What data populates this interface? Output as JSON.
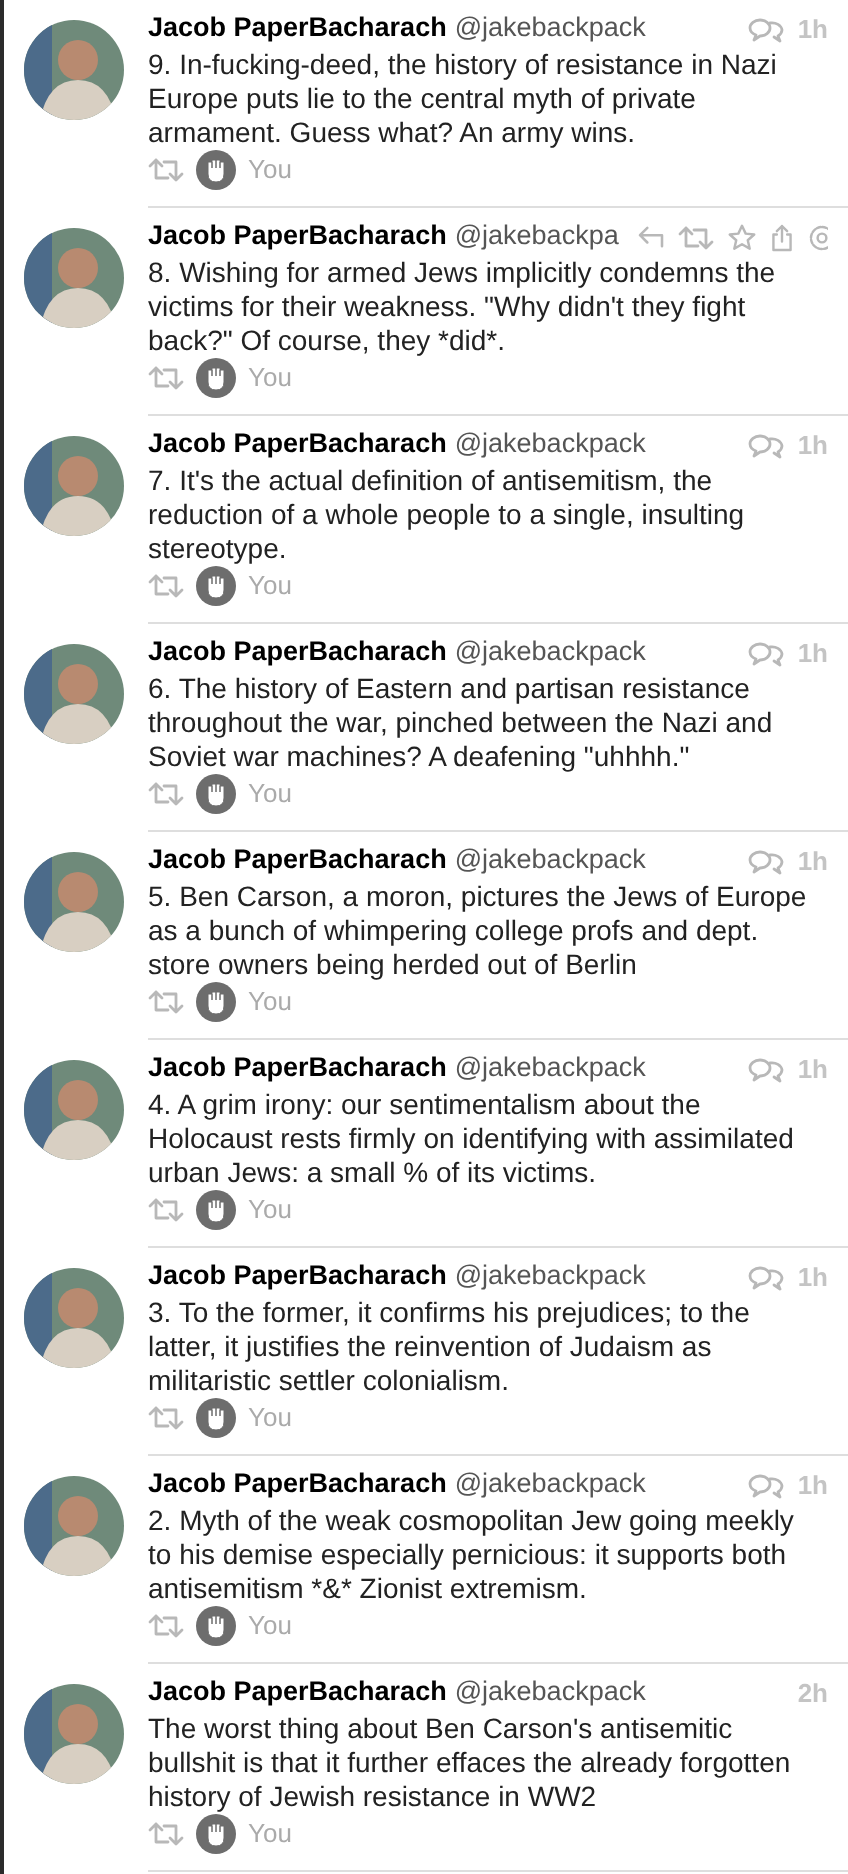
{
  "tweets": [
    {
      "name": "Jacob PaperBacharach",
      "handle": "@jakebackpack",
      "time": "1h",
      "conversation": true,
      "hovered": false,
      "text": "9. In-fucking-deed, the history of resistance in Nazi Europe puts lie to the central myth of private armament. Guess what? An army wins.",
      "liked_by": "You"
    },
    {
      "name": "Jacob PaperBacharach",
      "handle": "@jakebackpa",
      "conversation": false,
      "hovered": true,
      "text": "8. Wishing for armed Jews implicitly condemns the victims for their weakness. \"Why didn't they fight back?\" Of course, they *did*.",
      "liked_by": "You"
    },
    {
      "name": "Jacob PaperBacharach",
      "handle": "@jakebackpack",
      "time": "1h",
      "conversation": true,
      "hovered": false,
      "text": "7. It's the actual definition of antisemitism, the reduction of a whole people to a single, insulting stereotype.",
      "liked_by": "You"
    },
    {
      "name": "Jacob PaperBacharach",
      "handle": "@jakebackpack",
      "time": "1h",
      "conversation": true,
      "hovered": false,
      "text": "6. The history of Eastern and partisan resistance throughout the war, pinched between the Nazi and Soviet war machines? A deafening \"uhhhh.\"",
      "liked_by": "You"
    },
    {
      "name": "Jacob PaperBacharach",
      "handle": "@jakebackpack",
      "time": "1h",
      "conversation": true,
      "hovered": false,
      "text": "5. Ben Carson, a moron, pictures the Jews of Europe as a bunch of whimpering college profs and dept. store owners being herded out of Berlin",
      "liked_by": "You"
    },
    {
      "name": "Jacob PaperBacharach",
      "handle": "@jakebackpack",
      "time": "1h",
      "conversation": true,
      "hovered": false,
      "text": "4. A grim irony: our sentimentalism about the Holocaust rests firmly on identifying with assimilated urban Jews: a small % of its victims.",
      "liked_by": "You"
    },
    {
      "name": "Jacob PaperBacharach",
      "handle": "@jakebackpack",
      "time": "1h",
      "conversation": true,
      "hovered": false,
      "text": "3. To the former, it confirms his prejudices; to the latter, it justifies the reinvention of Judaism as militaristic settler colonialism.",
      "liked_by": "You"
    },
    {
      "name": "Jacob PaperBacharach",
      "handle": "@jakebackpack",
      "time": "1h",
      "conversation": true,
      "hovered": false,
      "text": "2. Myth of the weak cosmopolitan Jew going meekly to his demise especially pernicious: it supports both antisemitism *&* Zionist extremism.",
      "liked_by": "You"
    },
    {
      "name": "Jacob PaperBacharach",
      "handle": "@jakebackpack",
      "time": "2h",
      "conversation": false,
      "hovered": false,
      "text": "The worst thing about Ben Carson's antisemitic bullshit is that it further effaces the already forgotten history of Jewish resistance in WW2",
      "liked_by": "You"
    }
  ]
}
